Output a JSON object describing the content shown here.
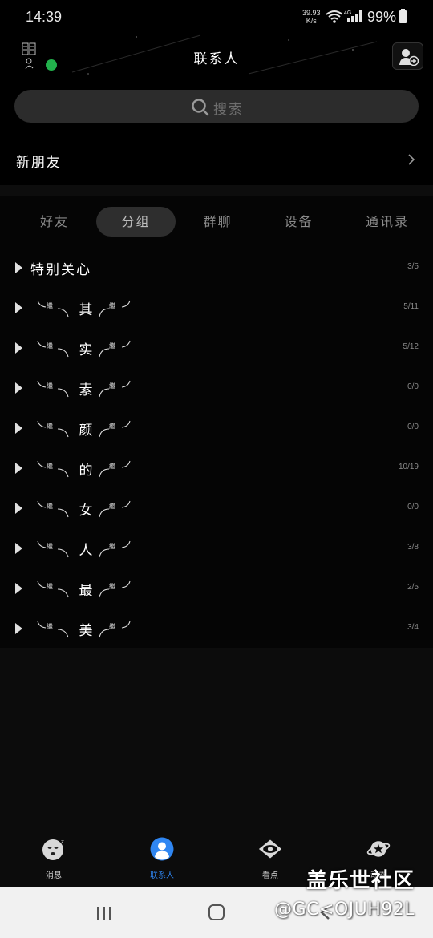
{
  "status_bar": {
    "time": "14:39",
    "net_speed_value": "39.93",
    "net_speed_unit": "K/s",
    "network_type": "4G",
    "battery": "99%"
  },
  "header": {
    "title": "联系人",
    "avatar_icon": "avatar-image",
    "online_color": "#22b14c",
    "add_icon": "add-contact-icon"
  },
  "search": {
    "placeholder": "搜索"
  },
  "new_friends": {
    "label": "新朋友"
  },
  "tabs": [
    {
      "label": "好友",
      "active": false
    },
    {
      "label": "分组",
      "active": true
    },
    {
      "label": "群聊",
      "active": false
    },
    {
      "label": "设备",
      "active": false
    },
    {
      "label": "通讯录",
      "active": false
    }
  ],
  "groups": [
    {
      "name": "特别关心",
      "count": "3/5"
    },
    {
      "char": "其",
      "count": "5/11"
    },
    {
      "char": "实",
      "count": "5/12"
    },
    {
      "char": "素",
      "count": "0/0"
    },
    {
      "char": "颜",
      "count": "0/0"
    },
    {
      "char": "的",
      "count": "10/19"
    },
    {
      "char": "女",
      "count": "0/0"
    },
    {
      "char": "人",
      "count": "3/8"
    },
    {
      "char": "最",
      "count": "2/5"
    },
    {
      "char": "美",
      "count": "3/4"
    }
  ],
  "bottom_nav": [
    {
      "label": "消息",
      "icon": "message-icon",
      "active": false
    },
    {
      "label": "联系人",
      "icon": "contacts-icon",
      "active": true
    },
    {
      "label": "看点",
      "icon": "eye-icon",
      "active": false
    },
    {
      "label": "动态",
      "icon": "planet-icon",
      "active": false
    }
  ],
  "watermark": {
    "title": "盖乐世社区",
    "handle": "@GC<OJUH92L"
  },
  "colors": {
    "accent": "#2f86f2",
    "background": "#000000"
  }
}
